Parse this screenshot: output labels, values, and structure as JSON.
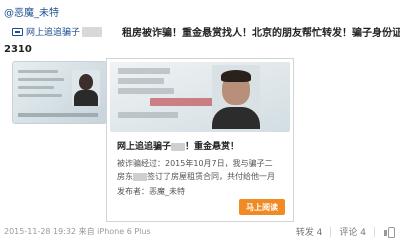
{
  "post": {
    "author": "@恶魔_未特",
    "link_label": "网上追追骗子",
    "headline": "租房被诈骗！重金悬赏找人！北京的朋友帮忙转发！骗子身份证：",
    "id_prefix": "2310"
  },
  "card": {
    "title": "网上追追骗子",
    "title_suffix": "！重金悬赏！",
    "body_1": "被诈骗经过：2015年10月7日，我与骗子二",
    "body_2": "房东",
    "body_3": "签订了房屋租赁合同，共付给他一月",
    "publisher_label": "发布者：恶魔_未特",
    "read_button": "马上阅读"
  },
  "footer": {
    "timestamp": "2015-11-28 19:32 来自 iPhone 6 Plus",
    "repost": "转发 4",
    "comment": "评论 4"
  }
}
